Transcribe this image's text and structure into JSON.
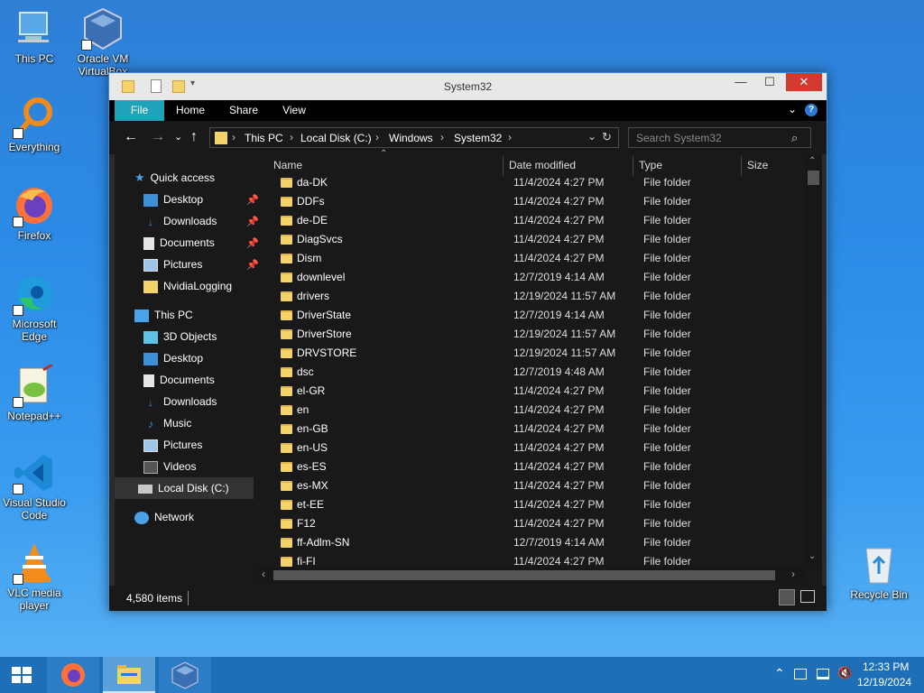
{
  "desktop": {
    "icons": [
      {
        "label": "This PC"
      },
      {
        "label": "Oracle VM VirtualBox"
      },
      {
        "label": "Everything"
      },
      {
        "label": "Firefox"
      },
      {
        "label": "Microsoft Edge"
      },
      {
        "label": "Notepad++"
      },
      {
        "label": "Visual Studio Code"
      },
      {
        "label": "VLC media player"
      },
      {
        "label": "Recycle Bin"
      }
    ]
  },
  "window": {
    "title": "System32",
    "controls": {
      "minimize": "—",
      "maximize": "☐",
      "close": "✕"
    },
    "ribbon": {
      "tabs": [
        "File",
        "Home",
        "Share",
        "View"
      ],
      "active": "File",
      "help": "?"
    },
    "address": {
      "breadcrumb": [
        "This PC",
        "Local Disk (C:)",
        "Windows",
        "System32"
      ],
      "separator": "›",
      "search_placeholder": "Search System32"
    },
    "nav": {
      "quick_access": "Quick access",
      "quick_items": [
        {
          "label": "Desktop",
          "pinned": true
        },
        {
          "label": "Downloads",
          "pinned": true
        },
        {
          "label": "Documents",
          "pinned": true
        },
        {
          "label": "Pictures",
          "pinned": true
        },
        {
          "label": "NvidiaLogging",
          "pinned": false
        }
      ],
      "this_pc": "This PC",
      "pc_items": [
        {
          "label": "3D Objects"
        },
        {
          "label": "Desktop"
        },
        {
          "label": "Documents"
        },
        {
          "label": "Downloads"
        },
        {
          "label": "Music"
        },
        {
          "label": "Pictures"
        },
        {
          "label": "Videos"
        },
        {
          "label": "Local Disk (C:)",
          "selected": true
        }
      ],
      "network": "Network"
    },
    "columns": {
      "name": "Name",
      "date": "Date modified",
      "type": "Type",
      "size": "Size"
    },
    "files": [
      {
        "name": "da-DK",
        "date": "11/4/2024 4:27 PM",
        "type": "File folder"
      },
      {
        "name": "DDFs",
        "date": "11/4/2024 4:27 PM",
        "type": "File folder"
      },
      {
        "name": "de-DE",
        "date": "11/4/2024 4:27 PM",
        "type": "File folder"
      },
      {
        "name": "DiagSvcs",
        "date": "11/4/2024 4:27 PM",
        "type": "File folder"
      },
      {
        "name": "Dism",
        "date": "11/4/2024 4:27 PM",
        "type": "File folder"
      },
      {
        "name": "downlevel",
        "date": "12/7/2019 4:14 AM",
        "type": "File folder"
      },
      {
        "name": "drivers",
        "date": "12/19/2024 11:57 AM",
        "type": "File folder"
      },
      {
        "name": "DriverState",
        "date": "12/7/2019 4:14 AM",
        "type": "File folder"
      },
      {
        "name": "DriverStore",
        "date": "12/19/2024 11:57 AM",
        "type": "File folder"
      },
      {
        "name": "DRVSTORE",
        "date": "12/19/2024 11:57 AM",
        "type": "File folder"
      },
      {
        "name": "dsc",
        "date": "12/7/2019 4:48 AM",
        "type": "File folder"
      },
      {
        "name": "el-GR",
        "date": "11/4/2024 4:27 PM",
        "type": "File folder"
      },
      {
        "name": "en",
        "date": "11/4/2024 4:27 PM",
        "type": "File folder"
      },
      {
        "name": "en-GB",
        "date": "11/4/2024 4:27 PM",
        "type": "File folder"
      },
      {
        "name": "en-US",
        "date": "11/4/2024 4:27 PM",
        "type": "File folder"
      },
      {
        "name": "es-ES",
        "date": "11/4/2024 4:27 PM",
        "type": "File folder"
      },
      {
        "name": "es-MX",
        "date": "11/4/2024 4:27 PM",
        "type": "File folder"
      },
      {
        "name": "et-EE",
        "date": "11/4/2024 4:27 PM",
        "type": "File folder"
      },
      {
        "name": "F12",
        "date": "11/4/2024 4:27 PM",
        "type": "File folder"
      },
      {
        "name": "ff-Adlm-SN",
        "date": "12/7/2019 4:14 AM",
        "type": "File folder"
      },
      {
        "name": "fi-FI",
        "date": "11/4/2024 4:27 PM",
        "type": "File folder"
      }
    ],
    "status": {
      "item_count": "4,580 items"
    }
  },
  "taskbar": {
    "apps": [
      "start-icon",
      "firefox-icon",
      "file-explorer-icon",
      "virtualbox-icon"
    ],
    "active_app": "file-explorer-icon",
    "clock": {
      "time": "12:33 PM",
      "date": "12/19/2024"
    }
  },
  "colors": {
    "accent": "#1fa3b8",
    "taskbar": "#1d6fb8",
    "folder": "#f5d36b",
    "close": "#e81123"
  }
}
